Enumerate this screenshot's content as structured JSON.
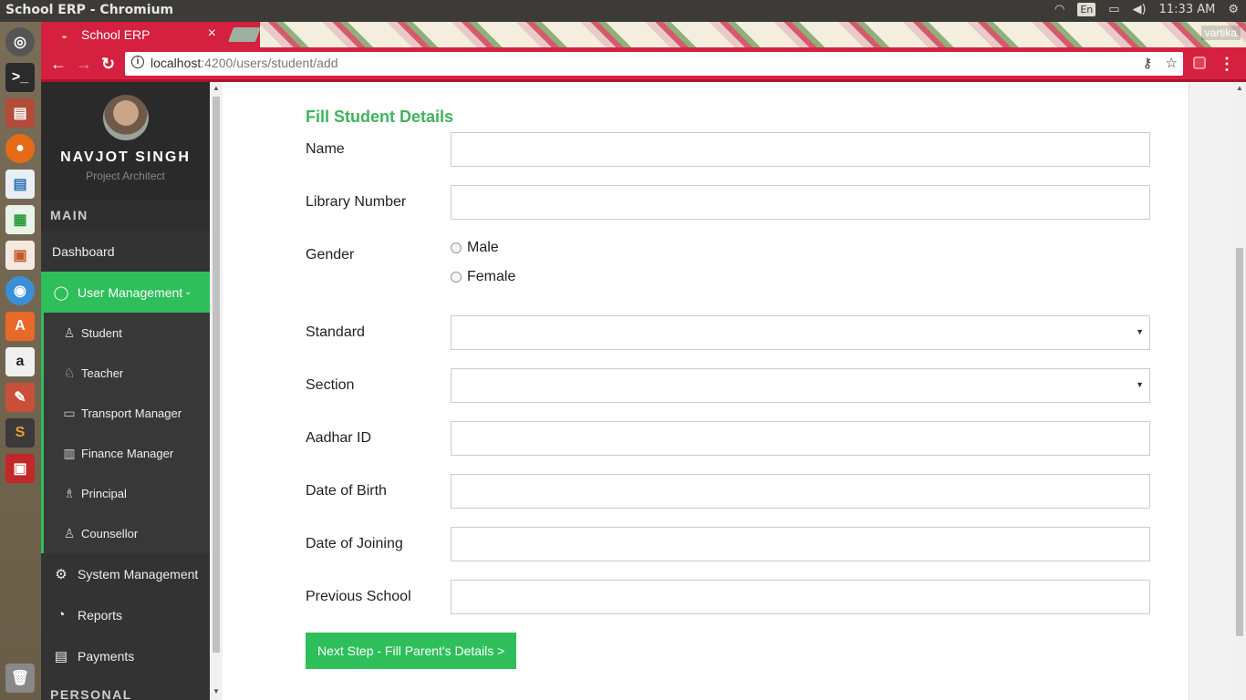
{
  "os": {
    "window_title": "School ERP - Chromium",
    "lang": "En",
    "clock": "11:33 AM"
  },
  "browser": {
    "tab_title": "School ERP",
    "profile_name": "vartika",
    "url_host": "localhost",
    "url_path": ":4200/users/student/add"
  },
  "sidebar": {
    "user_name": "NAVJOT SINGH",
    "user_role": "Project Architect",
    "section_main": "MAIN",
    "dashboard": "Dashboard",
    "user_management": "User Management",
    "sub_items": [
      "Student",
      "Teacher",
      "Transport Manager",
      "Finance Manager",
      "Principal",
      "Counsellor"
    ],
    "system_management": "System Management",
    "reports": "Reports",
    "payments": "Payments",
    "section_personal": "PERSONAL"
  },
  "form": {
    "title": "Fill Student Details",
    "name_label": "Name",
    "library_label": "Library Number",
    "gender_label": "Gender",
    "gender_male": "Male",
    "gender_female": "Female",
    "standard_label": "Standard",
    "section_label": "Section",
    "aadhar_label": "Aadhar ID",
    "dob_label": "Date of Birth",
    "doj_label": "Date of Joining",
    "prev_school_label": "Previous School",
    "next_button": "Next Step - Fill Parent's Details >"
  }
}
